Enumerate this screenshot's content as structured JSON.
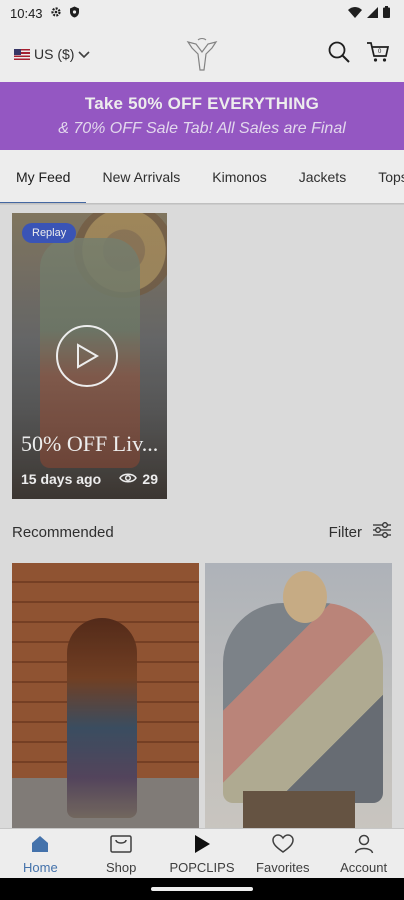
{
  "status_bar": {
    "time": "10:43"
  },
  "header": {
    "currency": "US ($)"
  },
  "promo": {
    "title": "Take 50% OFF EVERYTHING",
    "subtitle": "& 70% OFF Sale Tab! All Sales are Final",
    "background_color": "#a05ed1"
  },
  "tabs": [
    {
      "label": "My Feed",
      "active": true
    },
    {
      "label": "New Arrivals"
    },
    {
      "label": "Kimonos"
    },
    {
      "label": "Jackets"
    },
    {
      "label": "Tops"
    }
  ],
  "feed": {
    "video": {
      "badge": "Replay",
      "title": "50% OFF Liv...",
      "posted": "15 days ago",
      "views": "29"
    }
  },
  "recommended": {
    "heading": "Recommended",
    "filter_label": "Filter"
  },
  "bottom_nav": [
    {
      "label": "Home",
      "icon": "home-icon",
      "active": true
    },
    {
      "label": "Shop",
      "icon": "shop-icon"
    },
    {
      "label": "POPCLIPS",
      "icon": "play-icon"
    },
    {
      "label": "Favorites",
      "icon": "heart-icon"
    },
    {
      "label": "Account",
      "icon": "person-icon"
    }
  ],
  "colors": {
    "accent": "#4a7bb8",
    "replay_badge": "#3f5bc4"
  }
}
